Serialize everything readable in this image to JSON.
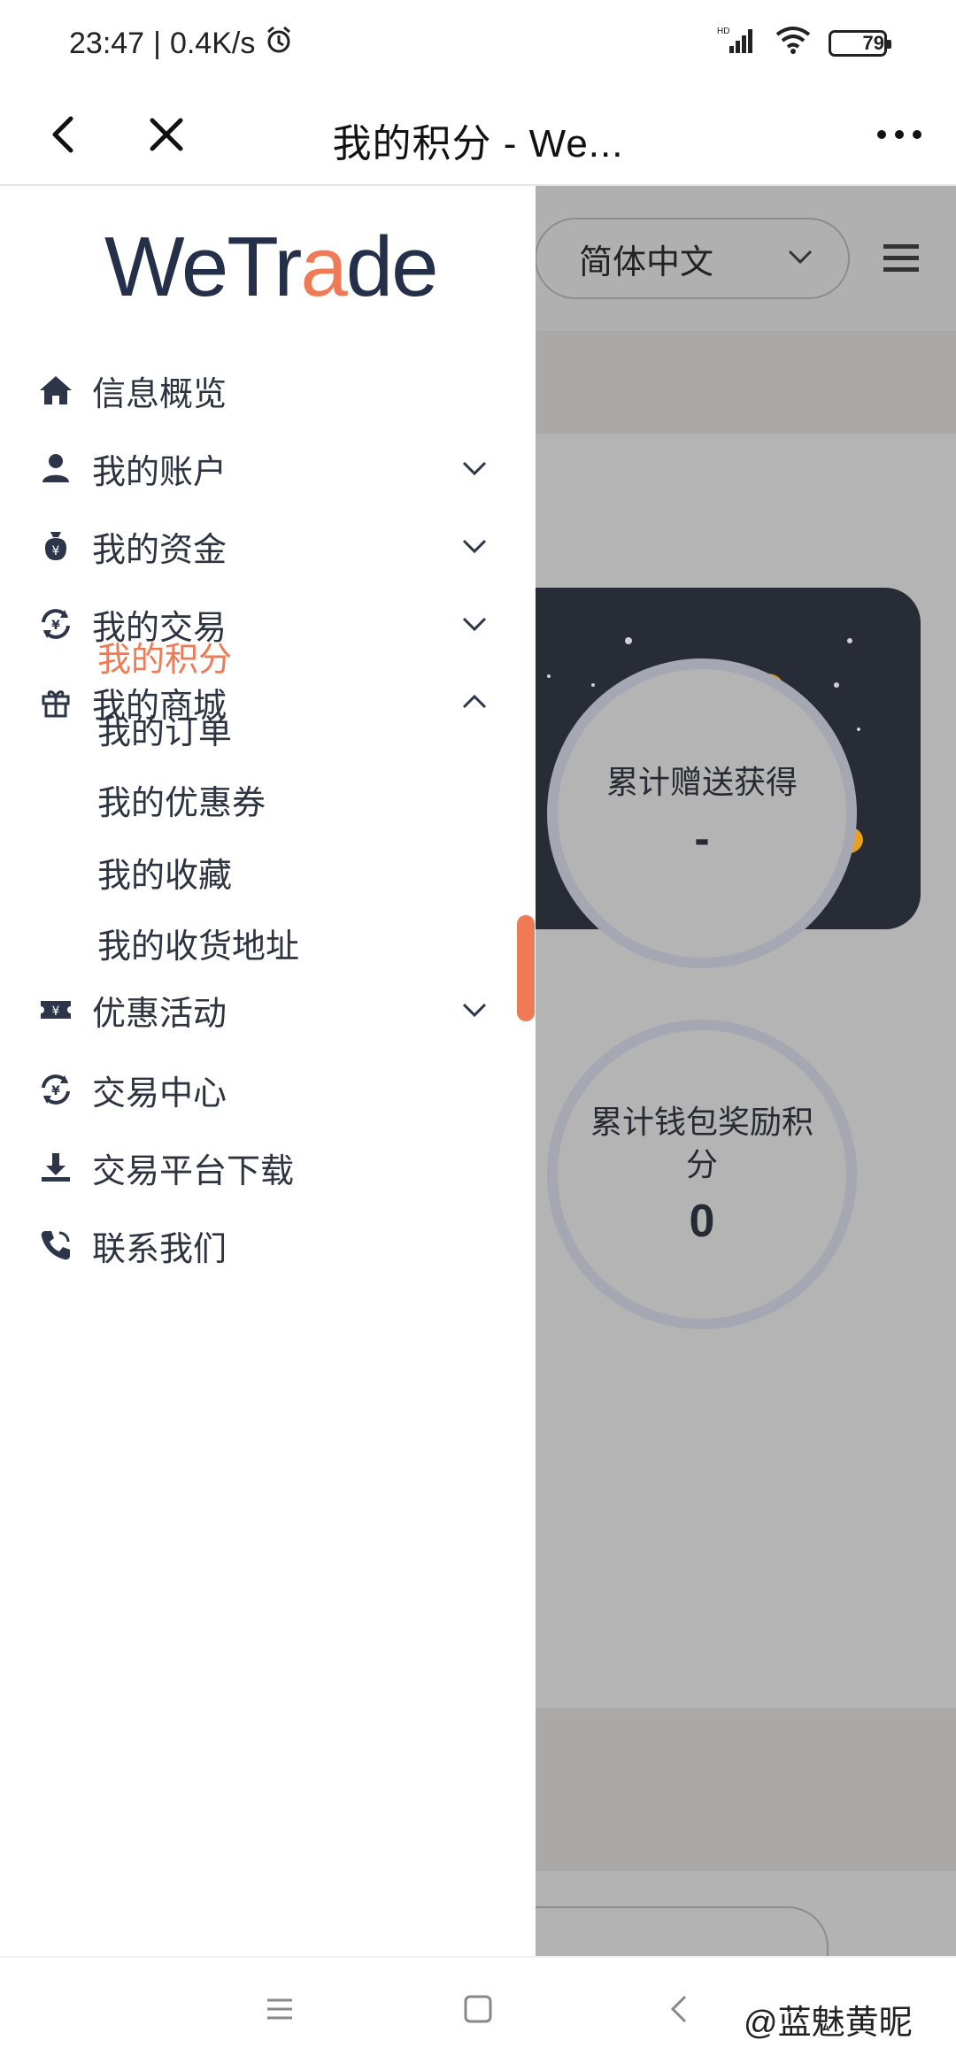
{
  "status_bar": {
    "time": "23:47",
    "speed": "0.4K/s",
    "network_label": "HD",
    "battery": "79"
  },
  "title_bar": {
    "title": "我的积分 - We..."
  },
  "background_page": {
    "language_select": "简体中文",
    "stat_gift_label": "累计赠送获得",
    "stat_gift_value": "-",
    "stat_wallet_label": "累计钱包奖励积分",
    "stat_wallet_value": "0"
  },
  "drawer": {
    "logo_prefix": "WeTr",
    "logo_accent": "a",
    "logo_suffix": "de",
    "items": [
      {
        "label": "信息概览",
        "icon": "home-icon",
        "expandable": false
      },
      {
        "label": "我的账户",
        "icon": "user-icon",
        "expandable": true,
        "expanded": false
      },
      {
        "label": "我的资金",
        "icon": "money-bag-icon",
        "expandable": true,
        "expanded": false
      },
      {
        "label": "我的交易",
        "icon": "exchange-icon",
        "expandable": true,
        "expanded": false
      },
      {
        "label": "我的商城",
        "icon": "gift-icon",
        "expandable": true,
        "expanded": true
      }
    ],
    "mall_sub_items": [
      {
        "label": "我的积分",
        "active": true
      },
      {
        "label": "我的订单",
        "active": false
      },
      {
        "label": "我的优惠券",
        "active": false
      },
      {
        "label": "我的收藏",
        "active": false
      },
      {
        "label": "我的收货地址",
        "active": false
      }
    ],
    "bottom_items": [
      {
        "label": "优惠活动",
        "icon": "ticket-icon",
        "expandable": true
      },
      {
        "label": "交易中心",
        "icon": "exchange-icon",
        "expandable": false
      },
      {
        "label": "交易平台下载",
        "icon": "download-icon",
        "expandable": false
      },
      {
        "label": "联系我们",
        "icon": "phone-icon",
        "expandable": false
      }
    ]
  },
  "watermark": "@蓝魅黄昵",
  "colors": {
    "accent": "#ef7a56",
    "navy": "#243049",
    "overlay": "#b3b3b3",
    "gift_card": "#282c36"
  }
}
